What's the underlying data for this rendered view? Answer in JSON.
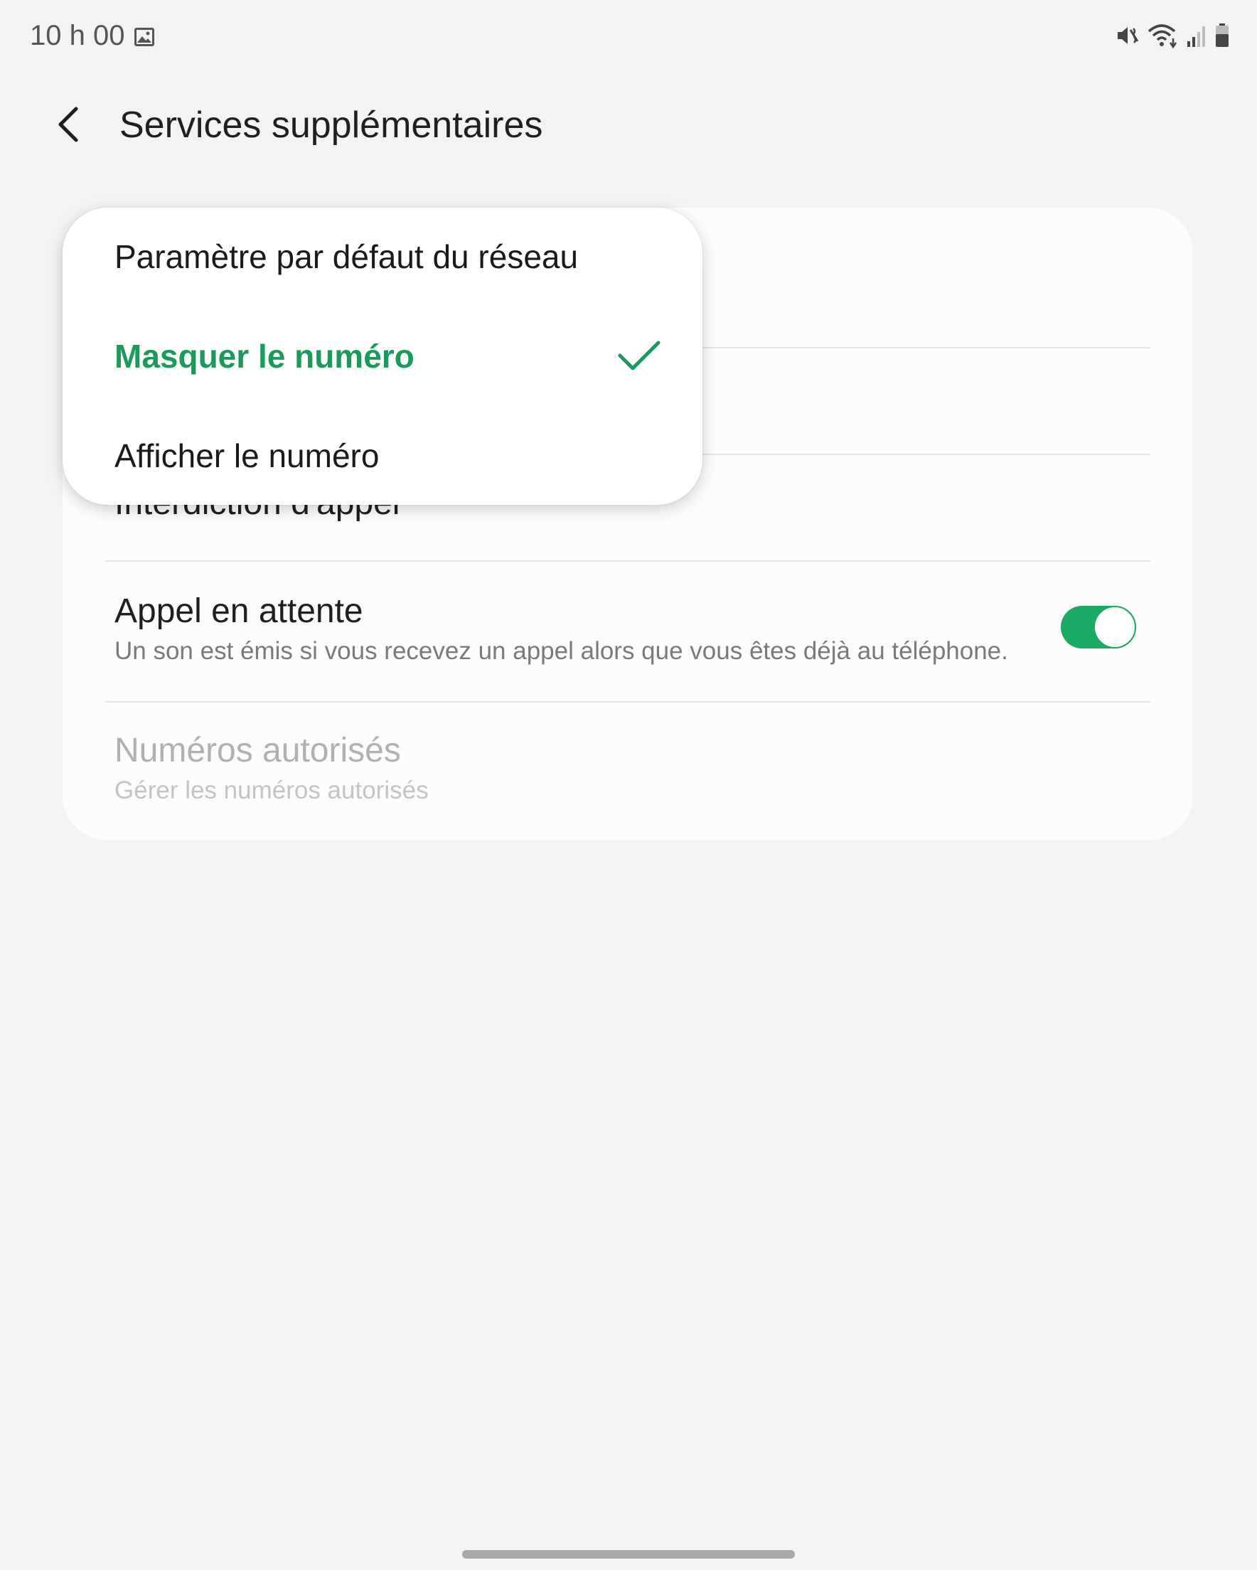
{
  "status_bar": {
    "time": "10 h 00",
    "icons": [
      "gallery-icon",
      "mute-vibrate-icon",
      "wifi-icon",
      "signal-icon",
      "battery-icon"
    ]
  },
  "app_bar": {
    "title": "Services supplémentaires",
    "back_icon": "chevron-left-icon"
  },
  "settings": {
    "rows": [
      {
        "title": "Interdiction d'appel"
      },
      {
        "title": "Appel en attente",
        "subtitle": "Un son est émis si vous recevez un appel alors que vous êtes déjà au téléphone.",
        "toggle_on": true
      },
      {
        "title": "Numéros autorisés",
        "subtitle": "Gérer les numéros autorisés",
        "disabled": true
      }
    ]
  },
  "popup_menu": {
    "items": [
      {
        "label": "Paramètre par défaut du réseau",
        "selected": false
      },
      {
        "label": "Masquer le numéro",
        "selected": true
      },
      {
        "label": "Afficher le numéro",
        "selected": false
      }
    ]
  },
  "colors": {
    "accent": "#1aaa63",
    "selected_text": "#1a9a5b",
    "background": "#f3f3f3",
    "card": "#fcfcfc"
  }
}
